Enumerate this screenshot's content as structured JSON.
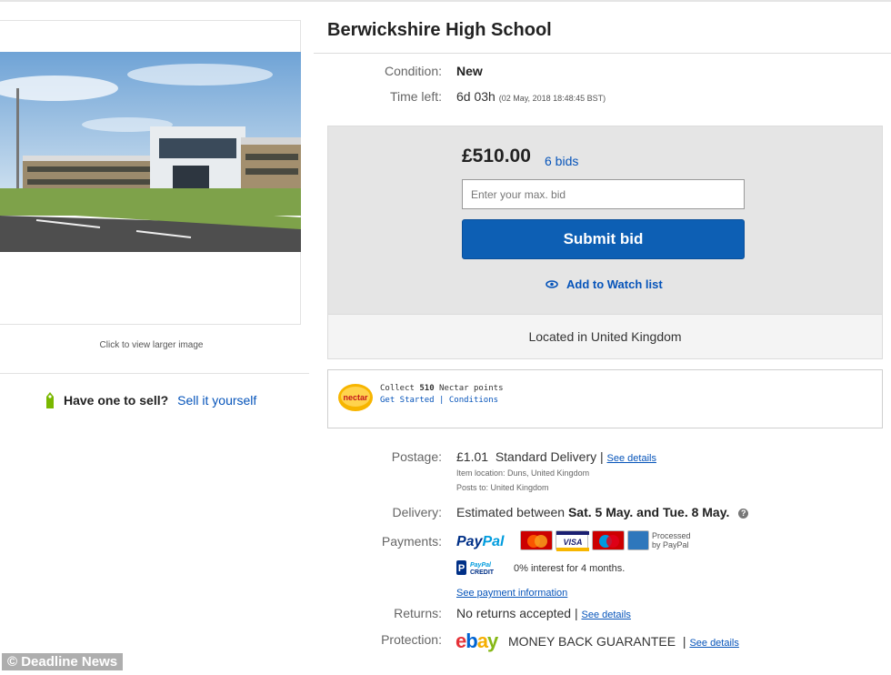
{
  "listing": {
    "title": "Berwickshire High School",
    "click_to_enlarge": "Click to view larger image"
  },
  "sell": {
    "question": "Have one to sell?",
    "link": "Sell it yourself"
  },
  "details": {
    "condition_label": "Condition:",
    "condition_value": "New",
    "time_label": "Time left:",
    "time_value": "6d 03h",
    "time_end": "(02 May, 2018   18:48:45 BST)"
  },
  "bid": {
    "price": "£510.00",
    "bids": "6 bids",
    "input_placeholder": "Enter your max. bid",
    "submit_label": "Submit bid",
    "watch_label": "Add to Watch list",
    "located": "Located in United Kingdom"
  },
  "nectar": {
    "logo_text": "nectar",
    "line1_prefix": "Collect",
    "points": "510",
    "line1_suffix": "Nectar points",
    "get_started": "Get Started",
    "separator": "|",
    "conditions": "Conditions"
  },
  "postage": {
    "label": "Postage:",
    "price": "£1.01",
    "method": "Standard Delivery",
    "separator": "|",
    "see_details": "See details",
    "item_location": "Item location:  Duns, United Kingdom",
    "posts_to": "Posts to:  United Kingdom"
  },
  "delivery": {
    "label": "Delivery:",
    "prefix": "Estimated between",
    "dates": "Sat. 5 May. and Tue. 8 May.",
    "info_icon": "?"
  },
  "payments": {
    "label": "Payments:",
    "paypal_a": "Pay",
    "paypal_b": "Pal",
    "cards": [
      "MasterCard",
      "VISA",
      "Maestro",
      "AMEX"
    ],
    "processed_1": "Processed",
    "processed_2": "by PayPal",
    "credit_text": "0% interest for 4 months.",
    "see_payment": "See payment information",
    "paypal_credit_icon": "paypal-credit-icon"
  },
  "returns": {
    "label": "Returns:",
    "value": "No returns accepted",
    "separator": "|",
    "see_details": "See details"
  },
  "protection": {
    "label": "Protection:",
    "ebay_e": "e",
    "ebay_b": "b",
    "ebay_a": "a",
    "ebay_y": "y",
    "guarantee": "MONEY BACK GUARANTEE",
    "separator": "|",
    "see_details": "See details"
  },
  "watermark": "© Deadline News",
  "colors": {
    "link": "#0654ba",
    "button": "#0d5fb4",
    "bid_panel": "#e5e5e5"
  }
}
